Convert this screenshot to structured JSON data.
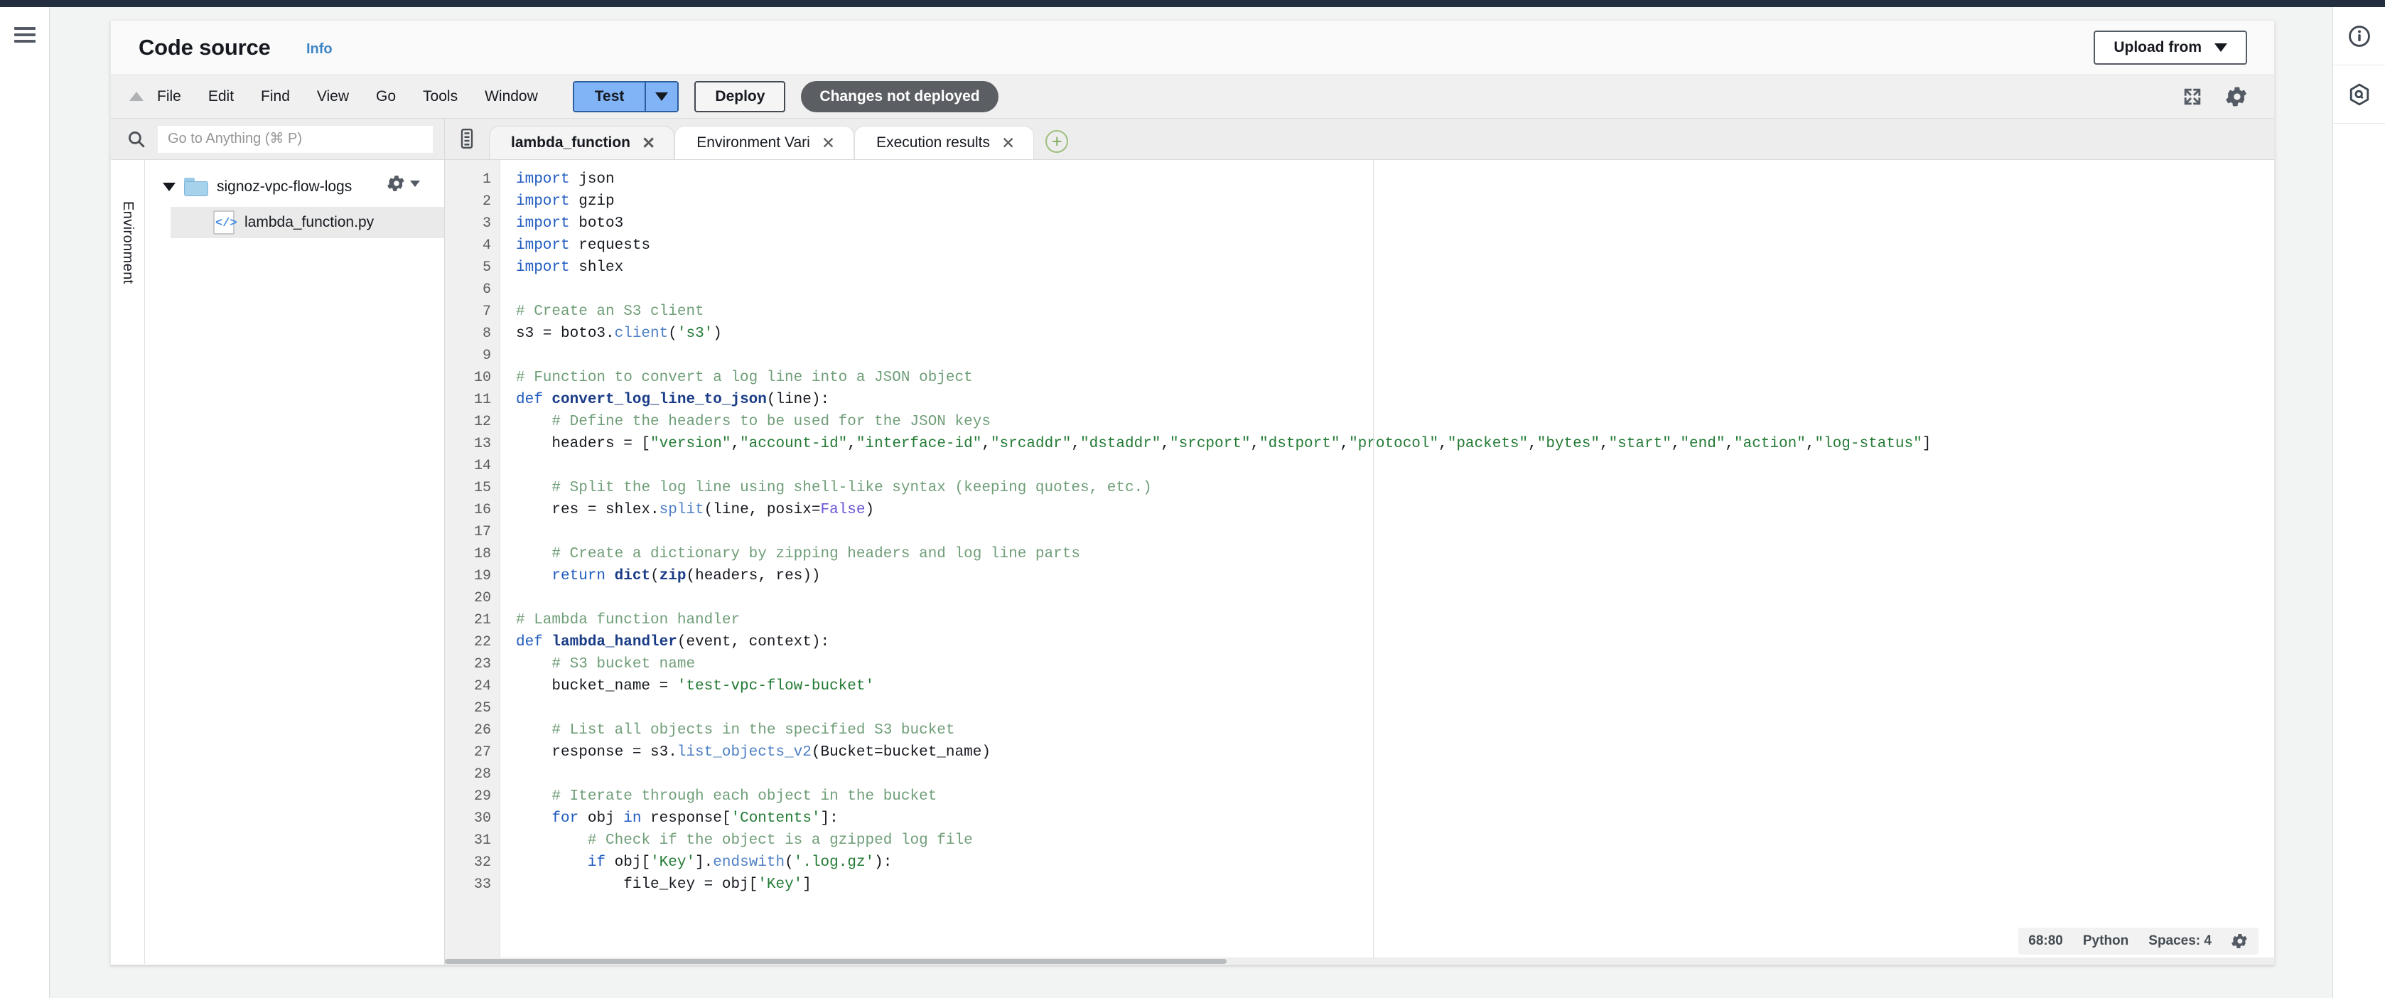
{
  "header": {
    "title": "Code source",
    "info_label": "Info",
    "upload_from_label": "Upload from"
  },
  "toolbar": {
    "menus": [
      "File",
      "Edit",
      "Find",
      "View",
      "Go",
      "Tools",
      "Window"
    ],
    "test_label": "Test",
    "deploy_label": "Deploy",
    "changes_badge": "Changes not deployed",
    "expand_icon": "expand-icon",
    "settings_icon": "gear-icon",
    "collapse_icon": "collapse-triangle-icon"
  },
  "explorer": {
    "search_placeholder": "Go to Anything (⌘ P)",
    "search_icon": "search-icon",
    "side_tab_label": "Environment",
    "folder": {
      "name": "signoz-vpc-flow-logs",
      "expanded": true,
      "gear_icon": "gear-icon"
    },
    "files": [
      {
        "name": "lambda_function.py",
        "icon": "code-file-icon",
        "selected": true
      }
    ]
  },
  "editor": {
    "tabs_icon": "tabs-list-icon",
    "add_tab_icon": "plus-icon",
    "tabs": [
      {
        "label": "lambda_function",
        "active": true,
        "closable": true
      },
      {
        "label": "Environment Vari",
        "active": false,
        "closable": true
      },
      {
        "label": "Execution results",
        "active": false,
        "closable": true
      }
    ],
    "status": {
      "cursor": "68:80",
      "language": "Python",
      "indent": "Spaces: 4",
      "gear_icon": "gear-icon"
    },
    "line_numbers": [
      1,
      2,
      3,
      4,
      5,
      6,
      7,
      8,
      9,
      10,
      11,
      12,
      13,
      14,
      15,
      16,
      17,
      18,
      19,
      20,
      21,
      22,
      23,
      24,
      25,
      26,
      27,
      28,
      29,
      30,
      31,
      32,
      33
    ],
    "code_lines": [
      "import json",
      "import gzip",
      "import boto3",
      "import requests",
      "import shlex",
      "",
      "# Create an S3 client",
      "s3 = boto3.client('s3')",
      "",
      "# Function to convert a log line into a JSON object",
      "def convert_log_line_to_json(line):",
      "    # Define the headers to be used for the JSON keys",
      "    headers = [\"version\",\"account-id\",\"interface-id\",\"srcaddr\",\"dstaddr\",\"srcport\",\"dstport\",\"protocol\",\"packets\",\"bytes\",\"start\",\"end\",\"action\",\"log-status\"]",
      "",
      "    # Split the log line using shell-like syntax (keeping quotes, etc.)",
      "    res = shlex.split(line, posix=False)",
      "",
      "    # Create a dictionary by zipping headers and log line parts",
      "    return dict(zip(headers, res))",
      "",
      "# Lambda function handler",
      "def lambda_handler(event, context):",
      "    # S3 bucket name",
      "    bucket_name = 'test-vpc-flow-bucket'",
      "",
      "    # List all objects in the specified S3 bucket",
      "    response = s3.list_objects_v2(Bucket=bucket_name)",
      "",
      "    # Iterate through each object in the bucket",
      "    for obj in response['Contents']:",
      "        # Check if the object is a gzipped log file",
      "        if obj['Key'].endswith('.log.gz'):",
      "            file_key = obj['Key']"
    ]
  },
  "left_rail": {
    "menu_icon": "hamburger-menu-icon"
  },
  "right_rail": {
    "items": [
      {
        "icon": "info-circle-icon"
      },
      {
        "icon": "hexagon-q-icon"
      }
    ]
  },
  "colors": {
    "accent_blue": "#3d85c6",
    "test_button": "#80b4f7",
    "badge_gray": "#5b5f63",
    "keyword": "#1f5bbf",
    "string": "#237a34",
    "comment": "#6f9e78",
    "constant": "#6a56d6",
    "topbar_dark": "#232f3e"
  }
}
